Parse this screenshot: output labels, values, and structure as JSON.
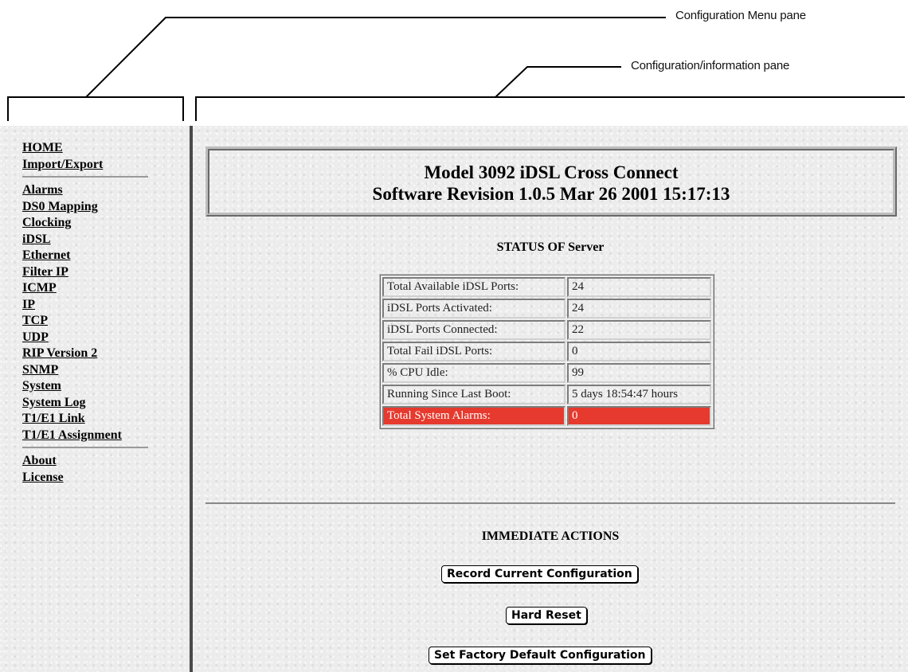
{
  "annotations": {
    "menu_pane_label": "Configuration Menu pane",
    "info_pane_label": "Configuration/information pane"
  },
  "menu": {
    "group1": [
      "HOME",
      "Import/Export"
    ],
    "group2": [
      "Alarms",
      "DS0 Mapping",
      "Clocking",
      "iDSL",
      "Ethernet",
      "Filter IP",
      "ICMP",
      "IP",
      "TCP",
      "UDP",
      "RIP Version 2",
      "SNMP",
      "System",
      "System Log",
      "T1/E1 Link",
      "T1/E1 Assignment"
    ],
    "group3": [
      "About",
      "License"
    ]
  },
  "header": {
    "line1": "Model 3092 iDSL Cross Connect",
    "line2": "Software Revision 1.0.5 Mar 26 2001 15:17:13"
  },
  "status": {
    "heading": "STATUS OF Server",
    "rows": [
      {
        "label": "Total Available iDSL Ports:",
        "value": "24"
      },
      {
        "label": "iDSL Ports Activated:",
        "value": "24"
      },
      {
        "label": "iDSL Ports Connected:",
        "value": "22"
      },
      {
        "label": "Total Fail iDSL Ports:",
        "value": "0"
      },
      {
        "label": "% CPU Idle:",
        "value": "99"
      },
      {
        "label": "Running Since Last Boot:",
        "value": "5 days 18:54:47 hours"
      },
      {
        "label": "Total System Alarms:",
        "value": "0"
      }
    ],
    "alarm_row_color": "#e63a2e"
  },
  "actions": {
    "heading": "IMMEDIATE ACTIONS",
    "record_label": "Record Current Configuration",
    "reset_label": "Hard Reset",
    "factory_label": "Set Factory Default Configuration"
  }
}
